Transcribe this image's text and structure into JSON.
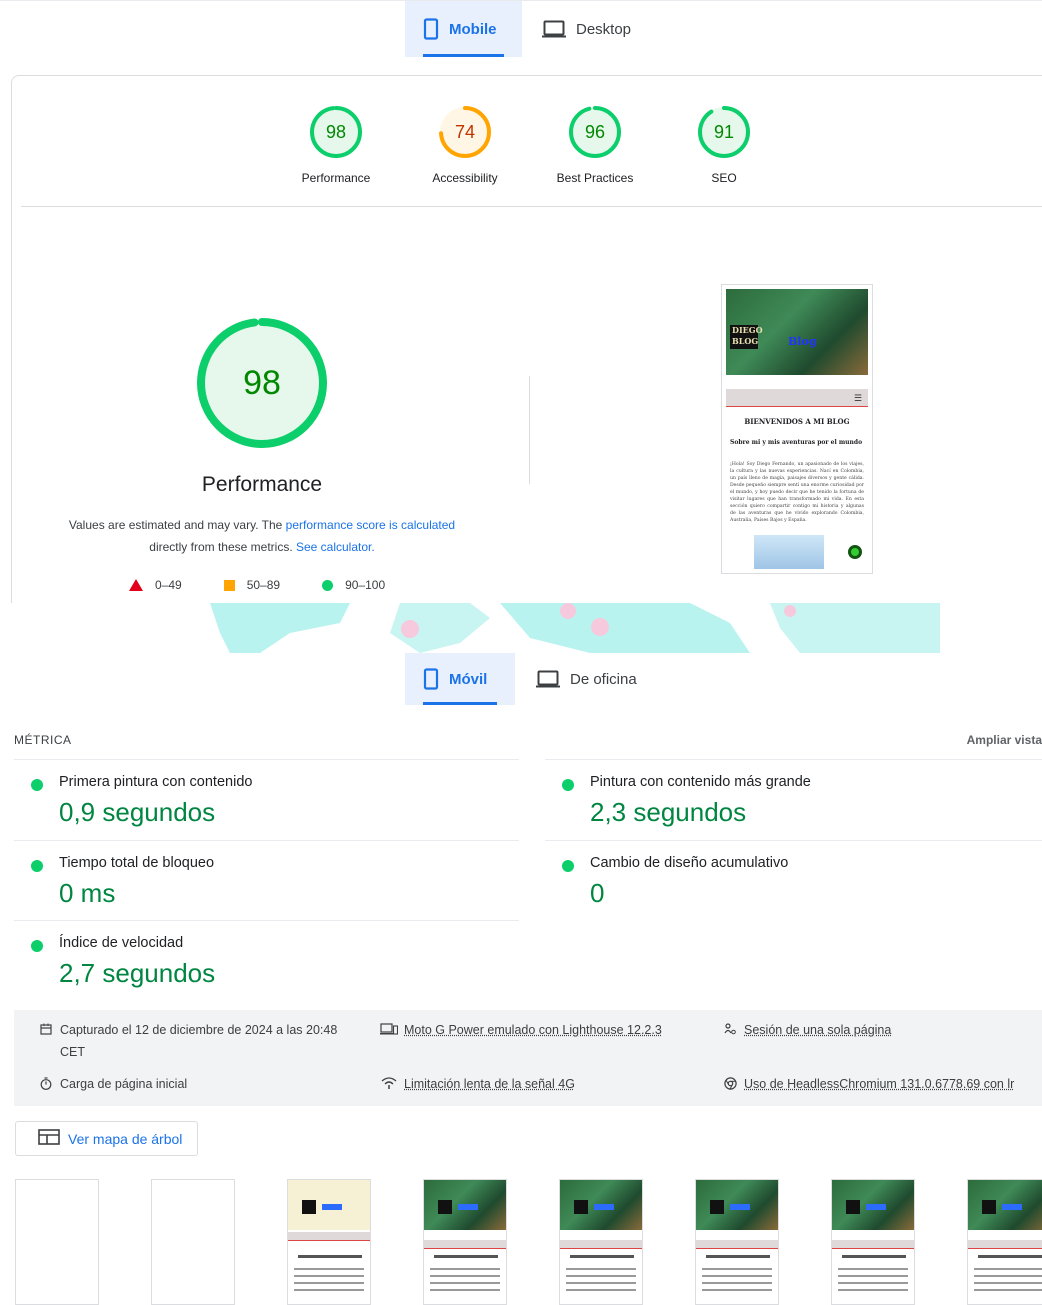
{
  "top_tabs": [
    {
      "label": "Mobile",
      "active": true
    },
    {
      "label": "Desktop",
      "active": false
    }
  ],
  "scores": [
    {
      "value": "98",
      "label": "Performance",
      "score": 98,
      "status": "pass"
    },
    {
      "value": "74",
      "label": "Accessibility",
      "score": 74,
      "status": "average"
    },
    {
      "value": "96",
      "label": "Best Practices",
      "score": 96,
      "status": "pass"
    },
    {
      "value": "91",
      "label": "SEO",
      "score": 91,
      "status": "pass"
    }
  ],
  "performance": {
    "score": "98",
    "title": "Performance",
    "desc_prefix": "Values are estimated and may vary. The ",
    "desc_link1": "performance score is calculated",
    "desc_middle": "directly from these metrics. ",
    "desc_link2": "See calculator."
  },
  "legend": [
    {
      "range": "0–49",
      "shape": "triangle",
      "color": "#e3001b"
    },
    {
      "range": "50–89",
      "shape": "square",
      "color": "#ffa400"
    },
    {
      "range": "90–100",
      "shape": "circle",
      "color": "#0cce6b"
    }
  ],
  "screenshot": {
    "logo": "DIEGO BLOG",
    "brand": "Blog",
    "heading": "BIENVENIDOS A MI BLOG",
    "subheading": "Sobre mi y mis aventuras por el mundo",
    "body": "¡Hola! Soy Diego Fernando, un apasionado de los viajes, la cultura y las nuevas experiencias. Nací en Colombia, un país lleno de magia, paisajes diversos y gente cálida. Desde pequeño siempre sentí una enorme curiosidad por el mundo, y hoy puedo decir que he tenido la fortuna de visitar lugares que han transformado mi vida. En esta sección quiero compartir contigo mi historia y algunas de las aventuras que he vivido explorando Colombia, Australia, Países Bajos y España."
  },
  "second_tabs": [
    {
      "label": "Móvil",
      "active": true
    },
    {
      "label": "De oficina",
      "active": false
    }
  ],
  "metrics": {
    "header": "MÉTRICA",
    "expand": "Ampliar vista",
    "items": [
      {
        "label": "Primera pintura con contenido",
        "value": "0,9 segundos"
      },
      {
        "label": "Pintura con contenido más grande",
        "value": "2,3 segundos"
      },
      {
        "label": "Tiempo total de bloqueo",
        "value": "0 ms"
      },
      {
        "label": "Cambio de diseño acumulativo",
        "value": "0"
      },
      {
        "label": "Índice de velocidad",
        "value": "2,7 segundos"
      }
    ]
  },
  "runtime": {
    "captured_line1": "Capturado el 12 de diciembre de 2024 a las 20:48",
    "captured_line2": "CET",
    "device": "Moto G Power emulado con Lighthouse 12.2.3",
    "session": "Sesión de una sola página",
    "load": "Carga de página inicial",
    "throttling": "Limitación lenta de la señal 4G",
    "browser": "Uso de HeadlessChromium 131.0.6778.69 con lr"
  },
  "treemap_button": "Ver mapa de árbol",
  "colors": {
    "pass": "#0cce6b",
    "pass_text": "#008800",
    "average": "#ffa400",
    "average_text": "#c33300",
    "accent": "#1a73e8",
    "metric_value": "#018642"
  }
}
